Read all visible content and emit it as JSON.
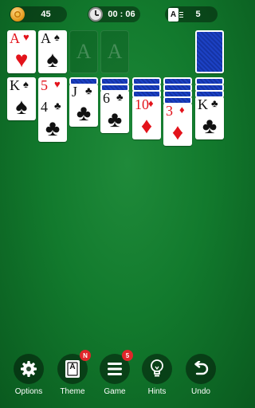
{
  "status_bar": {
    "coins": "45",
    "timer": "00 : 06",
    "moves": "5",
    "moves_icon_letter": "A"
  },
  "stock": {
    "face": "down"
  },
  "waste": [],
  "foundations": [
    {
      "rank": "A",
      "suit": "♥",
      "color": "red"
    },
    {
      "rank": "A",
      "suit": "♠",
      "color": "black"
    },
    {
      "rank": "A",
      "suit": "",
      "color": "empty"
    },
    {
      "rank": "A",
      "suit": "",
      "color": "empty"
    }
  ],
  "tableau": [
    {
      "face_down": 0,
      "face_up": [
        {
          "rank": "K",
          "suit": "♠",
          "color": "black"
        }
      ]
    },
    {
      "face_down": 0,
      "face_up": [
        {
          "rank": "5",
          "suit": "♥",
          "color": "red"
        },
        {
          "rank": "4",
          "suit": "♣",
          "color": "black"
        }
      ]
    },
    {
      "face_down": 1,
      "face_up": [
        {
          "rank": "J",
          "suit": "♣",
          "color": "black"
        }
      ]
    },
    {
      "face_down": 2,
      "face_up": [
        {
          "rank": "6",
          "suit": "♣",
          "color": "black"
        }
      ]
    },
    {
      "face_down": 3,
      "face_up": [
        {
          "rank": "10",
          "suit": "♦",
          "color": "red"
        }
      ]
    },
    {
      "face_down": 4,
      "face_up": [
        {
          "rank": "3",
          "suit": "♦",
          "color": "red"
        }
      ]
    },
    {
      "face_down": 3,
      "face_up": [
        {
          "rank": "K",
          "suit": "♣",
          "color": "black"
        }
      ]
    }
  ],
  "toolbar": {
    "options": {
      "label": "Options",
      "icon": "gear-icon"
    },
    "theme": {
      "label": "Theme",
      "icon": "theme-icon",
      "badge": "N",
      "icon_letter": "A"
    },
    "game": {
      "label": "Game",
      "icon": "menu-icon",
      "badge": "5"
    },
    "hints": {
      "label": "Hints",
      "icon": "lightbulb-icon"
    },
    "undo": {
      "label": "Undo",
      "icon": "undo-icon"
    }
  },
  "colors": {
    "felt": "#127a2d",
    "card_back": "#1c41c4",
    "red_suit": "#e3131b",
    "badge": "#e0262a"
  }
}
